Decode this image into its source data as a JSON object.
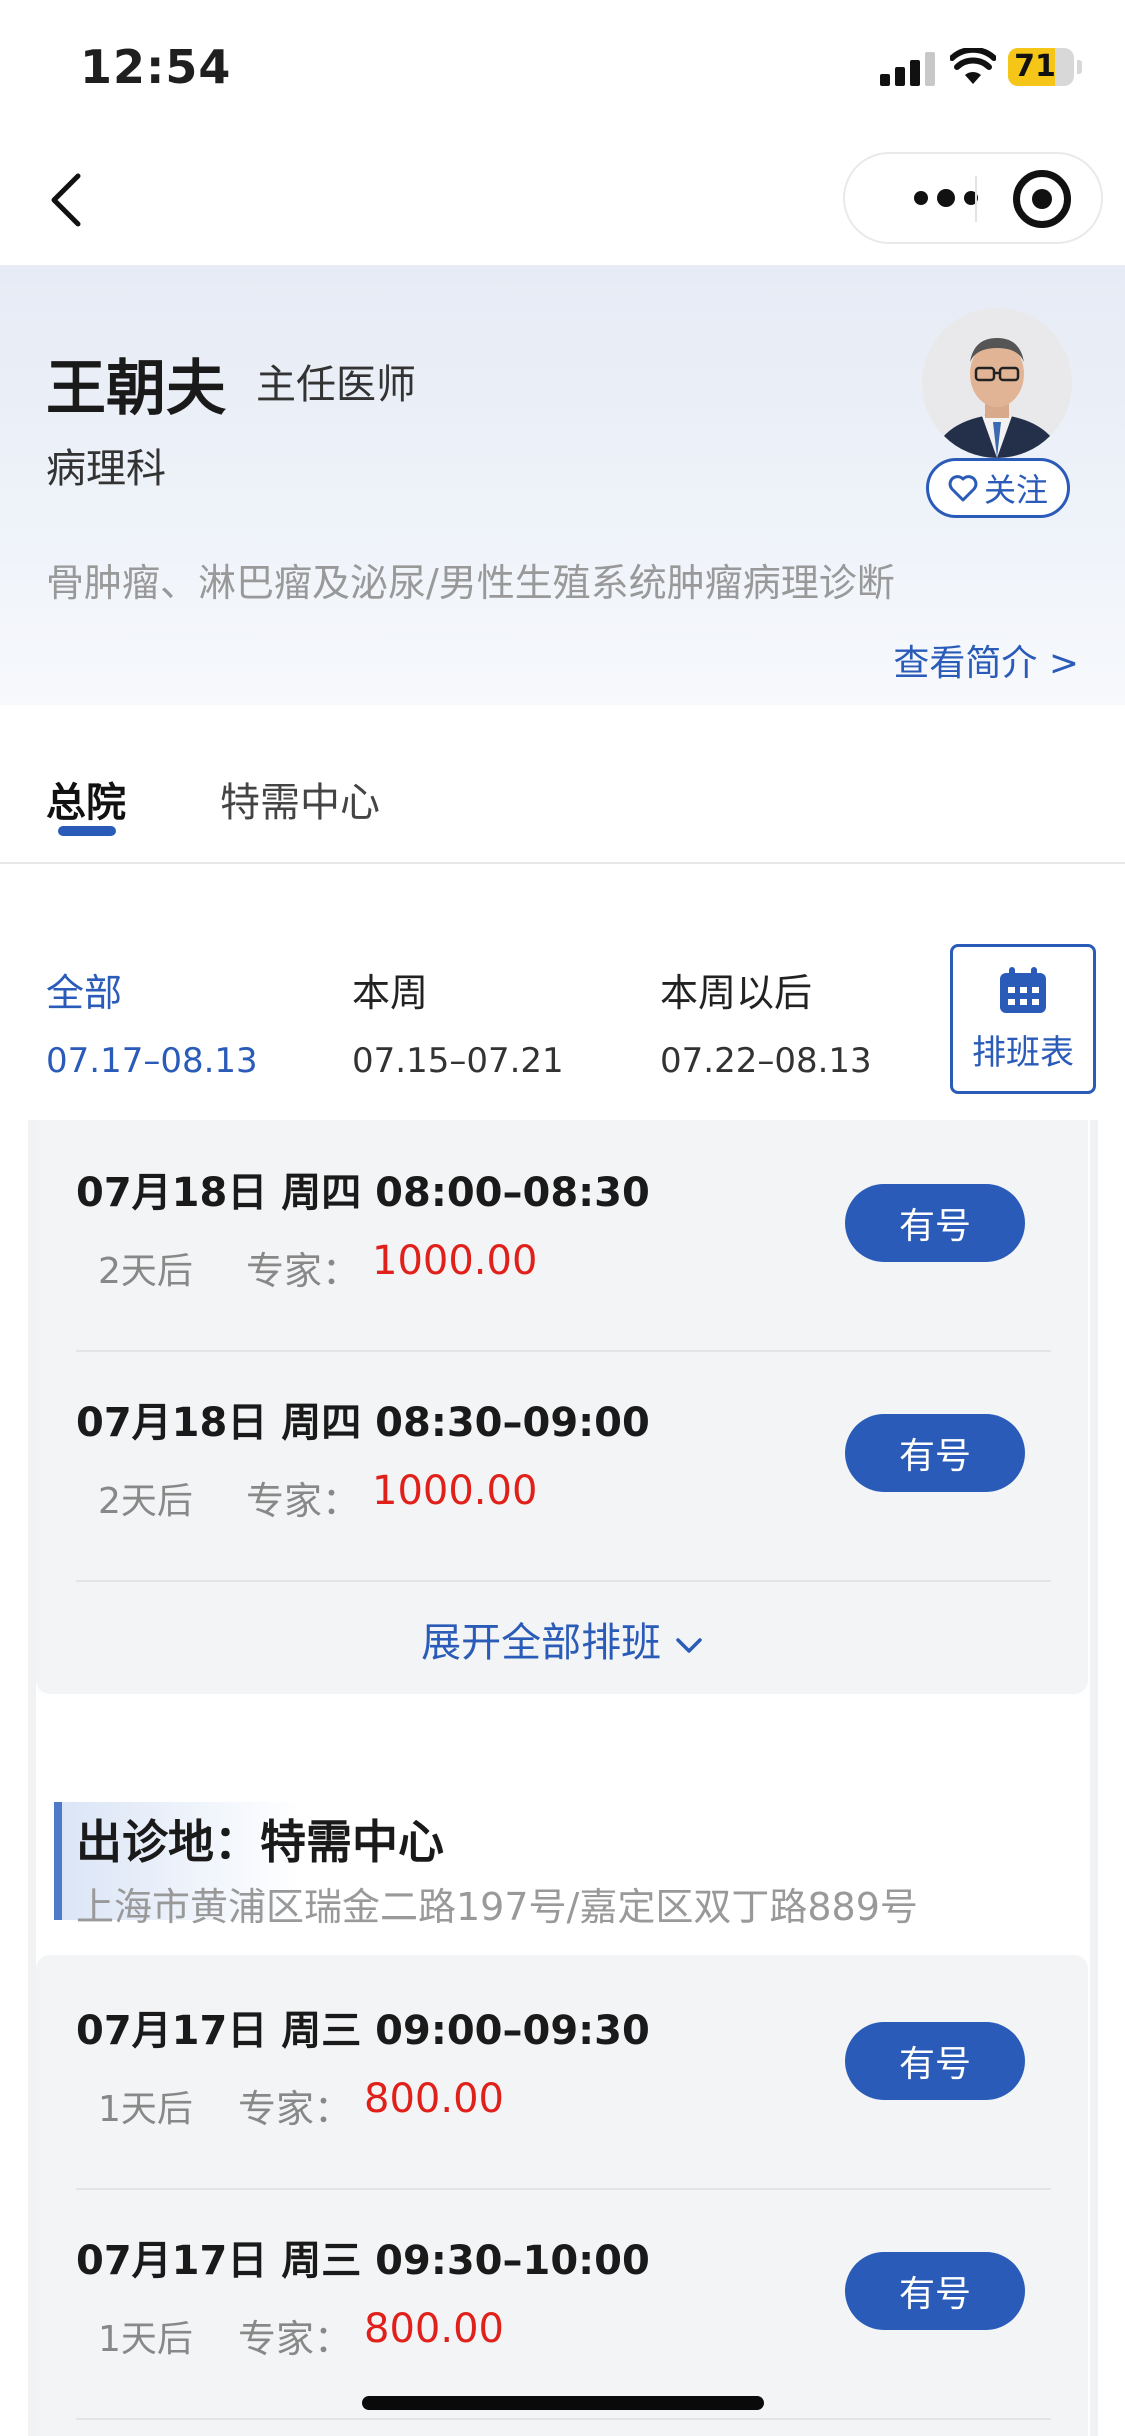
{
  "status_bar": {
    "time": "12:54",
    "battery": "71",
    "battery_level": 0.71
  },
  "doctor": {
    "name": "王朝夫",
    "title": "主任医师",
    "department": "病理科",
    "follow_label": "关注",
    "specialty": "骨肿瘤、淋巴瘤及泌尿/男性生殖系统肿瘤病理诊断",
    "view_intro": "查看简介 >"
  },
  "tabs": [
    {
      "label": "总院",
      "active": true
    },
    {
      "label": "特需中心",
      "active": false
    }
  ],
  "date_filters": [
    {
      "label": "全部",
      "range": "07.17–08.13",
      "active": true
    },
    {
      "label": "本周",
      "range": "07.15–07.21",
      "active": false
    },
    {
      "label": "本周以后",
      "range": "07.22–08.13",
      "active": false
    }
  ],
  "schedule_button": "排班表",
  "general_slots": [
    {
      "datetime": "07月18日  周四  08:00–08:30",
      "days": "2天后",
      "fee_label": "专家：",
      "fee": "1000.00",
      "status": "有号"
    },
    {
      "datetime": "07月18日  周四  08:30–09:00",
      "days": "2天后",
      "fee_label": "专家：",
      "fee": "1000.00",
      "status": "有号"
    }
  ],
  "expand_label": "展开全部排班",
  "special_location": {
    "title": "出诊地：特需中心",
    "address": "上海市黄浦区瑞金二路197号/嘉定区双丁路889号"
  },
  "special_slots": [
    {
      "datetime": "07月17日  周三  09:00–09:30",
      "days": "1天后",
      "fee_label": "专家：",
      "fee": "800.00",
      "status": "有号"
    },
    {
      "datetime": "07月17日  周三  09:30–10:00",
      "days": "1天后",
      "fee_label": "专家：",
      "fee": "800.00",
      "status": "有号"
    }
  ],
  "colors": {
    "accent": "#2a5bb8",
    "price": "#e0201b",
    "battery": "#f5c518"
  },
  "icons": [
    "back-icon",
    "more-dots-icon",
    "target-icon",
    "heart-icon",
    "calendar-icon",
    "chevron-down-icon",
    "signal-icon",
    "wifi-icon",
    "battery-icon"
  ]
}
